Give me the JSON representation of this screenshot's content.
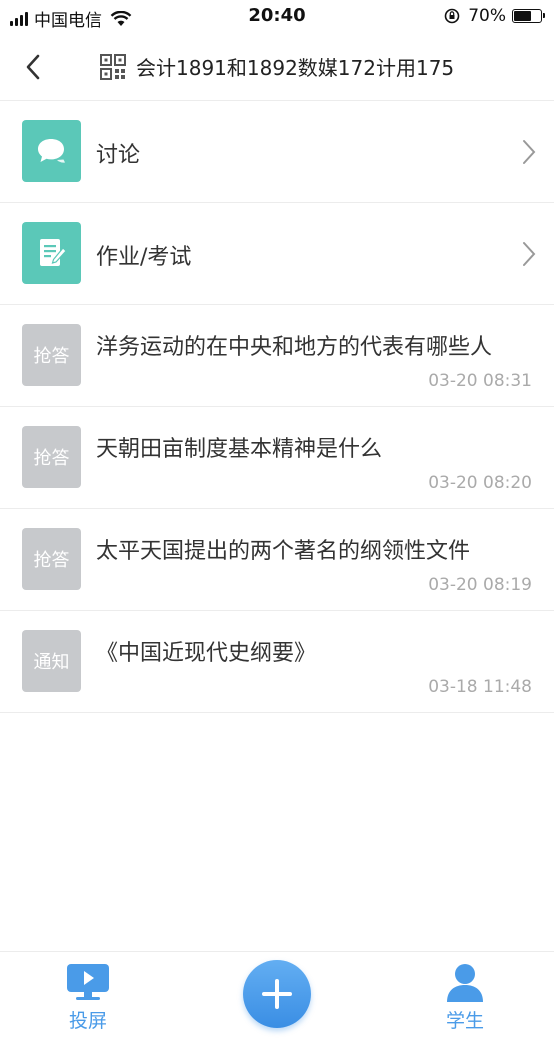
{
  "status_bar": {
    "carrier": "中国电信",
    "time": "20:40",
    "battery": "70%",
    "battery_level": 0.7
  },
  "nav": {
    "title": "会计1891和1892数媒172计用175",
    "back_icon": "chevron-left-icon",
    "qr_icon": "qr-code-icon"
  },
  "menu": [
    {
      "label": "讨论",
      "icon": "chat-bubble-icon"
    },
    {
      "label": "作业/考试",
      "icon": "document-edit-icon"
    }
  ],
  "items": [
    {
      "badge": "抢答",
      "title": "洋务运动的在中央和地方的代表有哪些人",
      "time": "03-20 08:31"
    },
    {
      "badge": "抢答",
      "title": "天朝田亩制度基本精神是什么",
      "time": "03-20 08:20"
    },
    {
      "badge": "抢答",
      "title": "太平天国提出的两个著名的纲领性文件",
      "time": "03-20 08:19"
    },
    {
      "badge": "通知",
      "title": "《中国近现代史纲要》",
      "time": "03-18 11:48"
    }
  ],
  "tabbar": {
    "left_label": "投屏",
    "right_label": "学生",
    "accent": "#4a9be8"
  }
}
